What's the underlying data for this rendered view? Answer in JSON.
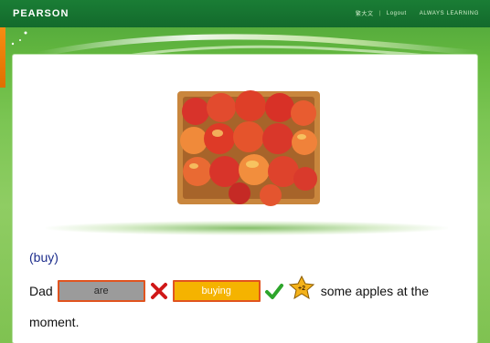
{
  "header": {
    "brand": "PEARSON",
    "links": [
      "繁大文",
      "Logout",
      "ALWAYS LEARNING"
    ]
  },
  "exercise": {
    "hint": "(buy)",
    "subject": "Dad",
    "wrong_answer": "are",
    "correct_answer": "buying",
    "points_badge": "+2",
    "rest_line1": "some apples at the",
    "rest_line2": "moment."
  },
  "colors": {
    "topbar": "#136a2c",
    "wrong_box": "#9b9b9b",
    "right_box": "#f5b300",
    "box_border": "#e1541f",
    "hint_text": "#1d2d8c",
    "cross": "#d01818",
    "check": "#2da52b"
  },
  "icons": {
    "wrong": "cross-icon",
    "correct": "check-icon",
    "reward": "star-icon",
    "image": "apples-basket-image"
  }
}
